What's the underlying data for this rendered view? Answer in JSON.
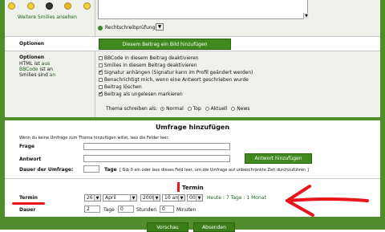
{
  "smilies": {
    "more_link": "Weitere Smilies ansehen"
  },
  "spellcheck": {
    "label": "Rechtschreibprüfung"
  },
  "options_bar": {
    "label": "Optionen",
    "add_button": "Diesem Beitrag ein Bild hinzufügen"
  },
  "options": {
    "title": "Optionen",
    "html_line": "HTML ist",
    "html_state": "aus",
    "bbcode_line": "BBCode",
    "bbcode_state": "ist an",
    "smilies_line": "Smilies sind",
    "smilies_state": "an",
    "checkboxes": [
      {
        "label": "BBCode in diesem Beitrag deaktivieren",
        "checked": false
      },
      {
        "label": "Smilies in diesem Beitrag deaktivieren",
        "checked": false
      },
      {
        "label": "Signatur anhängen (Signatur kann im Profil geändert werden)",
        "checked": true
      },
      {
        "label": "Benachrichtigt mich, wenn eine Antwort geschrieben wurde",
        "checked": false
      },
      {
        "label": "Beitrag löschen",
        "checked": false
      },
      {
        "label": "Beitrag als ungelesen markieren",
        "checked": true
      }
    ],
    "topic_type_label": "Thema schreiben als:",
    "topic_types": [
      {
        "label": "Normal",
        "selected": true
      },
      {
        "label": "Top",
        "selected": false
      },
      {
        "label": "Aktuell",
        "selected": false
      },
      {
        "label": "News",
        "selected": false
      }
    ]
  },
  "poll": {
    "heading": "Umfrage hinzufügen",
    "hint": "Wenn du keine Umfrage zum Thema hinzufügen willst, lass die Felder leer.",
    "question_label": "Frage",
    "answer_label": "Antwort",
    "add_answer_button": "Antwort hinzufügen",
    "duration_label": "Dauer der Umfrage:",
    "duration_unit": "Tage",
    "duration_hint": "[ Gib 0 ein oder lass dieses Feld leer, um die Umfrage auf unbeschränkte Zeit durchzuführen ]"
  },
  "termin": {
    "heading": "Termin",
    "label": "Termin",
    "day": "26",
    "month": "April",
    "year": "2008",
    "hour": "10 am",
    "minute": "00",
    "quick_today": "Heute",
    "quick_sep1": ":",
    "quick_7days": "7 Tage",
    "quick_sep2": ":",
    "quick_month": "1 Monat"
  },
  "duration": {
    "label": "Dauer",
    "days_value": "2",
    "days_unit": "Tage",
    "hours_value": "0",
    "hours_unit": "Stunden",
    "minutes_value": "0",
    "minutes_unit": "Minuten"
  },
  "buttons": {
    "preview": "Vorschau",
    "submit": "Absenden"
  },
  "colors": {
    "frame_green": "#4f8c2b",
    "button_green": "#3e8a1e",
    "link_green": "#1a5f1a",
    "annotation_red": "#e8161a"
  }
}
